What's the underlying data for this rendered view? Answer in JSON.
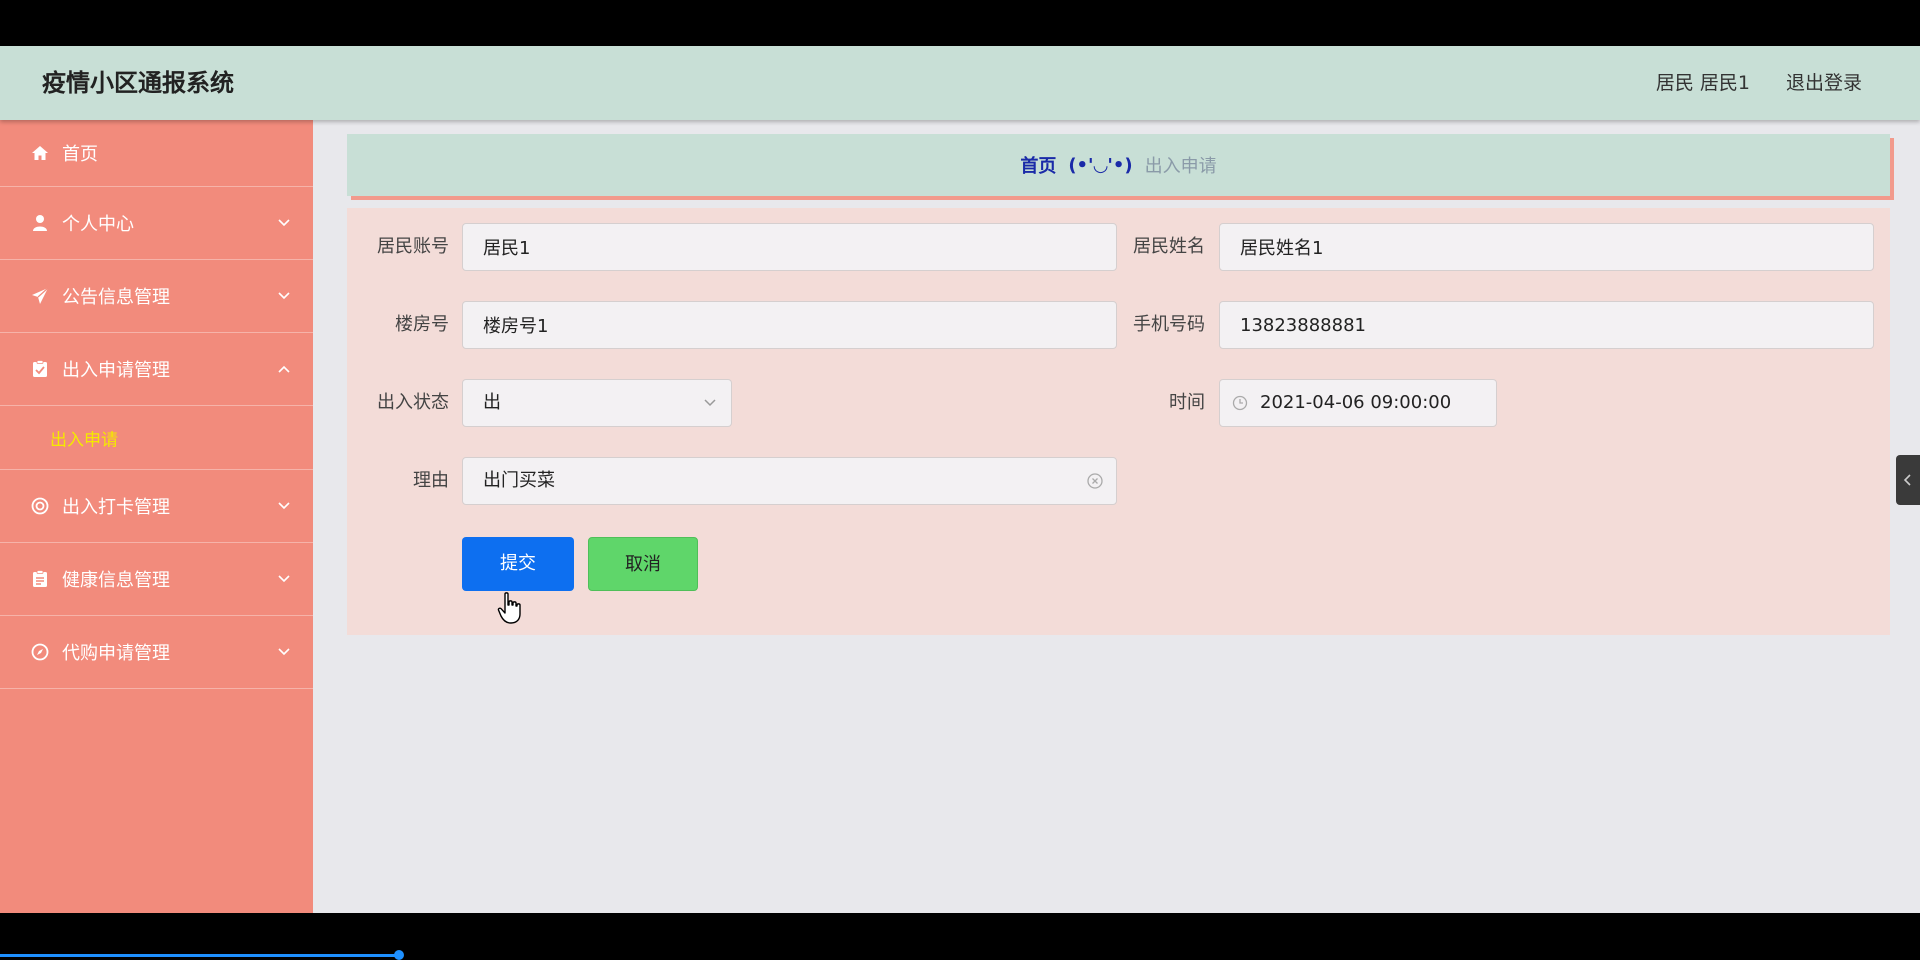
{
  "header": {
    "app_title": "疫情小区通报系统",
    "user": "居民 居民1",
    "logout": "退出登录"
  },
  "sidebar": {
    "items": [
      {
        "label": "首页",
        "icon": "home-icon"
      },
      {
        "label": "个人中心",
        "icon": "user-icon"
      },
      {
        "label": "公告信息管理",
        "icon": "paper-plane-icon"
      },
      {
        "label": "出入申请管理",
        "icon": "clipboard-check-icon"
      },
      {
        "label": "出入打卡管理",
        "icon": "lifebuoy-icon"
      },
      {
        "label": "健康信息管理",
        "icon": "clipboard-icon"
      },
      {
        "label": "代购申请管理",
        "icon": "compass-icon"
      }
    ],
    "submenu": {
      "label": "出入申请"
    }
  },
  "breadcrumb": {
    "home": "首页",
    "separator": "(•'◡'•)",
    "current": "出入申请"
  },
  "form": {
    "account_label": "居民账号",
    "account_value": "居民1",
    "name_label": "居民姓名",
    "name_value": "居民姓名1",
    "building_label": "楼房号",
    "building_value": "楼房号1",
    "phone_label": "手机号码",
    "phone_value": "13823888881",
    "status_label": "出入状态",
    "status_value": "出",
    "time_label": "时间",
    "time_value": "2021-04-06 09:00:00",
    "reason_label": "理由",
    "reason_value": "出门买菜",
    "submit_label": "提交",
    "cancel_label": "取消"
  },
  "colors": {
    "header_bg": "#c8dfd6",
    "sidebar_bg": "#f28b7c",
    "submenu_active": "#f5e900",
    "form_bg": "#f3dcd8",
    "submit_bg": "#0d6ff0",
    "cancel_bg": "#5fd66a"
  }
}
